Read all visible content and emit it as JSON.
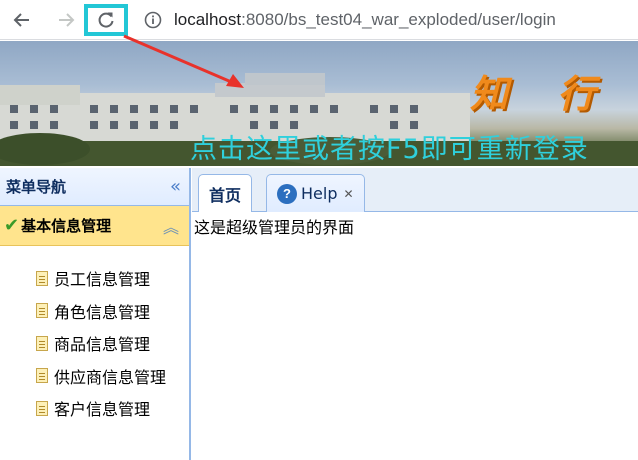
{
  "browser": {
    "url_host": "localhost",
    "url_path": ":8080/bs_test04_war_exploded/user/login"
  },
  "banner": {
    "brand_text": "知 行",
    "hint_text": "点击这里或者按F5即可重新登录"
  },
  "sidebar": {
    "title": "菜单导航",
    "group_title": "基本信息管理",
    "items": [
      {
        "label": "员工信息管理"
      },
      {
        "label": "角色信息管理"
      },
      {
        "label": "商品信息管理"
      },
      {
        "label": "供应商信息管理"
      },
      {
        "label": "客户信息管理"
      }
    ]
  },
  "tabs": [
    {
      "label": "首页"
    },
    {
      "label": "Help"
    }
  ],
  "content": {
    "text": "这是超级管理员的界面"
  },
  "colors": {
    "highlight_box": "#22c7d6",
    "arrow": "#e8322b",
    "hint_text": "#2fd0dc",
    "group_header": "#ffe48d"
  },
  "icons": [
    "back-arrow-icon",
    "forward-arrow-icon",
    "reload-icon",
    "info-icon",
    "collapse-icon",
    "checkmark-icon",
    "expand-up-icon",
    "document-icon",
    "help-icon",
    "close-icon"
  ]
}
